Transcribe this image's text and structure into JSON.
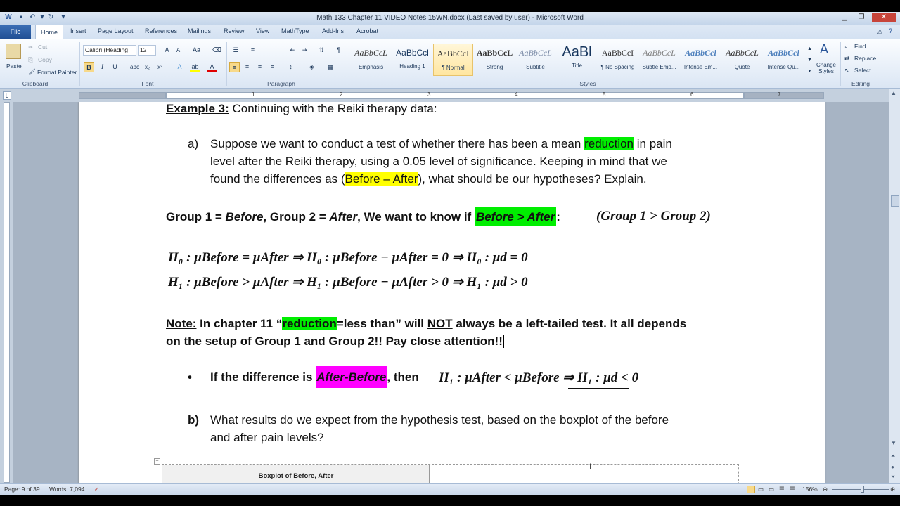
{
  "window": {
    "title": "Math 133 Chapter 11 VIDEO Notes 15WN.docx (Last saved by user) - Microsoft Word"
  },
  "tabs": [
    "File",
    "Home",
    "Insert",
    "Page Layout",
    "References",
    "Mailings",
    "Review",
    "View",
    "MathType",
    "Add-Ins",
    "Acrobat"
  ],
  "clipboard": {
    "paste": "Paste",
    "cut": "Cut",
    "copy": "Copy",
    "format_painter": "Format Painter",
    "label": "Clipboard"
  },
  "font": {
    "name": "Calibri (Heading",
    "size": "12",
    "label": "Font"
  },
  "paragraph": {
    "label": "Paragraph"
  },
  "styles": {
    "label": "Styles",
    "items": [
      {
        "sample": "AaBbCcL",
        "name": "Emphasis"
      },
      {
        "sample": "AaBbCcl",
        "name": "Heading 1"
      },
      {
        "sample": "AaBbCcI",
        "name": "¶ Normal"
      },
      {
        "sample": "AaBbCcL",
        "name": "Strong"
      },
      {
        "sample": "AaBbCcL",
        "name": "Subtitle"
      },
      {
        "sample": "AaBl",
        "name": "Title"
      },
      {
        "sample": "AaBbCcI",
        "name": "¶ No Spacing"
      },
      {
        "sample": "AaBbCcL",
        "name": "Subtle Emp..."
      },
      {
        "sample": "AaBbCcl",
        "name": "Intense Em..."
      },
      {
        "sample": "AaBbCcL",
        "name": "Quote"
      },
      {
        "sample": "AaBbCcl",
        "name": "Intense Qu..."
      }
    ],
    "change_styles": "Change Styles"
  },
  "editing": {
    "find": "Find",
    "replace": "Replace",
    "select": "Select",
    "label": "Editing"
  },
  "ruler": {
    "numbers": [
      "1",
      "2",
      "3",
      "4",
      "5",
      "6",
      "7"
    ]
  },
  "document": {
    "example_label": "Example 3:",
    "example_text": " Continuing with the Reiki therapy data:",
    "a_label": "a)",
    "a_line1_pre": "Suppose we want to conduct a test of whether there has been a mean ",
    "a_line1_hl": "reduction",
    "a_line1_post": " in pain",
    "a_line2": "level after the Reiki therapy, using a 0.05 level of significance. Keeping in mind that we",
    "a_line3_pre": "found the differences as (",
    "a_line3_hl": "Before – After",
    "a_line3_post": "), what should be our hypotheses? Explain.",
    "group_pre": "Group 1 = ",
    "group_before": "Before",
    "group_mid": ", Group 2 = ",
    "group_after": "After",
    "group_want": ", We want to know if ",
    "group_hl": "Before > After",
    "group_colon": ":",
    "group_math": "(Group 1 > Group 2)",
    "h0_a": "H",
    "h0_line": "H₀ : μBefore = μAfter   ⇒   H₀ : μBefore − μAfter = 0   ⇒   H₀ : μd = 0",
    "h1_line": "H₁ : μBefore > μAfter   ⇒   H₁ : μBefore − μAfter > 0   ⇒   H₁ : μd > 0",
    "note_label": "Note:",
    "note_pre": " In chapter 11 “",
    "note_hl": "reduction",
    "note_mid": "=less than” will ",
    "note_not": "NOT",
    "note_post": " always be a left-tailed test. It all depends",
    "note_line2": "on the setup of Group 1 and Group 2!! Pay close attention!!",
    "bullet": "•",
    "bullet_pre": "If the difference is ",
    "bullet_hl": "After-Before",
    "bullet_post": ", then",
    "bullet_math": "H₁ : μAfter < μBefore   ⇒ H₁ : μd < 0",
    "b_label": "b)",
    "b_line1": "What results do we expect from the hypothesis test, based on the boxplot of the before",
    "b_line2": "and after pain levels?",
    "boxplot_title": "Boxplot of Before, After"
  },
  "status": {
    "page": "Page: 9 of 39",
    "words": "Words: 7,094",
    "zoom": "156%"
  }
}
